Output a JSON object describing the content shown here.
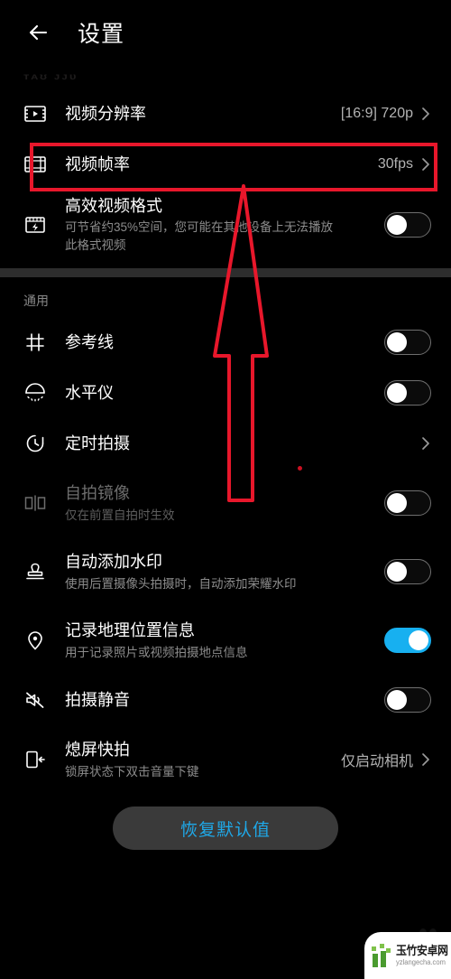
{
  "header": {
    "back_icon": "back-arrow-icon",
    "title": "设置"
  },
  "faint_caption": "ᴛᴀʊ ᴊᴊᴜ",
  "video_section": {
    "rows": [
      {
        "icon": "video-resolution-icon",
        "title": "视频分辨率",
        "value": "[16:9] 720p",
        "chevron": "chevron-right-icon"
      },
      {
        "icon": "video-framerate-icon",
        "title": "视频帧率",
        "value": "30fps",
        "chevron": "chevron-right-icon"
      },
      {
        "icon": "efficient-video-format-icon",
        "title": "高效视频格式",
        "subtitle": "可节省约35%空间，您可能在其他设备上无法播放此格式视频",
        "toggle": "off"
      }
    ]
  },
  "general_section": {
    "label": "通用",
    "rows": [
      {
        "icon": "grid-lines-icon",
        "title": "参考线",
        "toggle": "off"
      },
      {
        "icon": "level-meter-icon",
        "title": "水平仪",
        "toggle": "off"
      },
      {
        "icon": "timer-icon",
        "title": "定时拍摄",
        "value": "",
        "chevron": "chevron-right-icon"
      },
      {
        "icon": "mirror-icon",
        "title": "自拍镜像",
        "subtitle": "仅在前置自拍时生效",
        "toggle": "off",
        "disabled": true
      },
      {
        "icon": "watermark-stamp-icon",
        "title": "自动添加水印",
        "subtitle": "使用后置摄像头拍摄时，自动添加荣耀水印",
        "toggle": "off"
      },
      {
        "icon": "location-pin-icon",
        "title": "记录地理位置信息",
        "subtitle": "用于记录照片或视频拍摄地点信息",
        "toggle": "on"
      },
      {
        "icon": "mute-speaker-icon",
        "title": "拍摄静音",
        "toggle": "off"
      },
      {
        "icon": "screen-off-capture-icon",
        "title": "熄屏快拍",
        "subtitle": "锁屏状态下双击音量下键",
        "value": "仅启动相机",
        "chevron": "chevron-right-icon"
      }
    ]
  },
  "reset": {
    "label": "恢复默认值"
  },
  "annotation": {
    "box_name": "red-highlight-box",
    "arrow_name": "red-arrow-annotation",
    "color": "#e8172b"
  },
  "watermark": {
    "cn": "玉竹安卓网",
    "url": "yzlangecha.com"
  },
  "colors": {
    "background": "#000000",
    "toggle_on": "#17b0f0",
    "accent_text": "#1fa8e8",
    "separator": "#2d2d2d",
    "annotation_red": "#e8172b"
  }
}
